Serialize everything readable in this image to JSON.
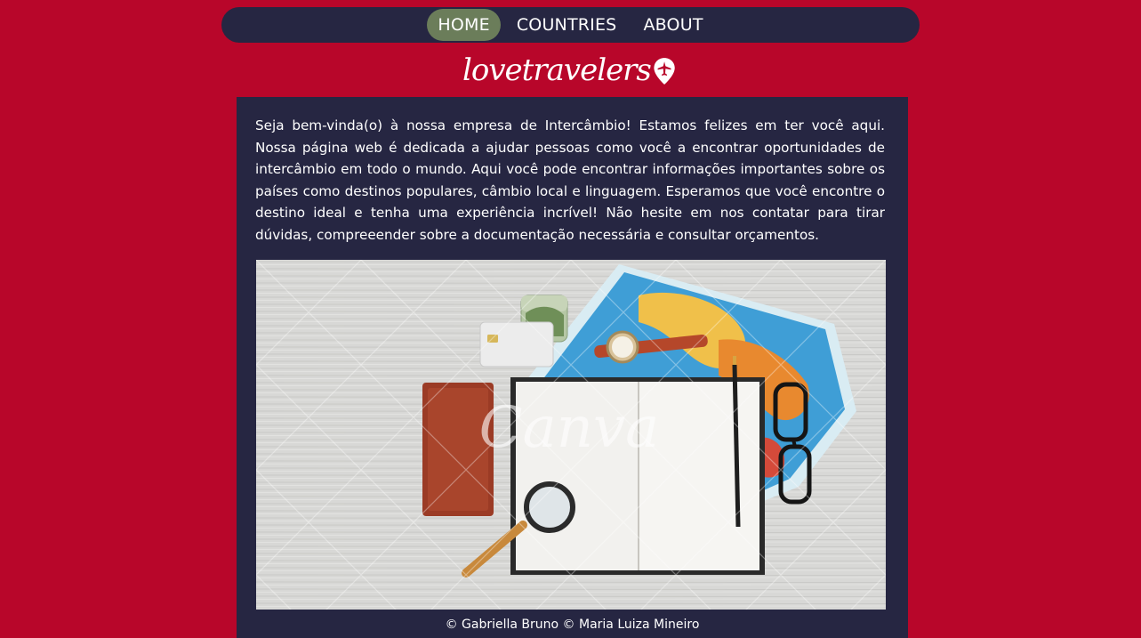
{
  "nav": {
    "items": [
      {
        "label": "HOME",
        "active": true
      },
      {
        "label": "COUNTRIES",
        "active": false
      },
      {
        "label": "ABOUT",
        "active": false
      }
    ]
  },
  "logo": {
    "text": "lovetravelers",
    "icon": "location-pin-airplane-icon"
  },
  "main": {
    "intro": "Seja bem-vinda(o) à nossa empresa de Intercâmbio! Estamos felizes em ter você aqui. Nossa página web é dedicada a ajudar pessoas como você a encontrar oportunidades de intercâmbio em todo o mundo. Aqui você pode encontrar informações importantes sobre os países como destinos populares, câmbio local e linguagem. Esperamos que você encontre o destino ideal e tenha uma experiência incrível! Não hesite em nos contatar para tirar dúvidas, compreeender sobre a documentação necessária e consultar orçamentos.",
    "image": {
      "watermark": "Canva"
    }
  },
  "footer": {
    "credits": "© Gabriella Bruno © Maria Luiza Mineiro"
  },
  "colors": {
    "background": "#b8062a",
    "panel": "#262642",
    "nav_active": "#6b7d5a",
    "text": "#ffffff"
  }
}
